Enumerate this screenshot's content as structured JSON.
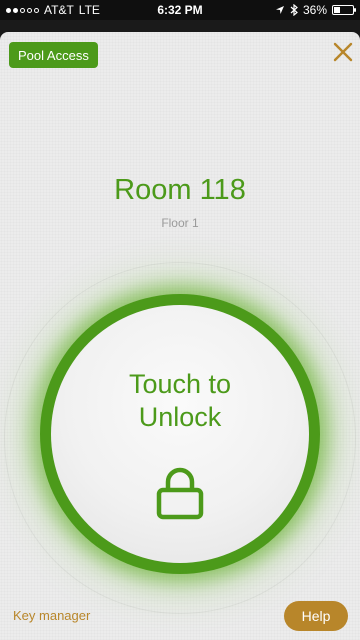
{
  "status_bar": {
    "carrier": "AT&T",
    "network": "LTE",
    "time": "6:32 PM",
    "battery": "36%",
    "battery_level": 0.36,
    "signal_bars_filled": 2,
    "signal_bars_total": 5
  },
  "header": {
    "pool_access_label": "Pool Access",
    "close_icon": "close-icon"
  },
  "room": {
    "title": "Room 118",
    "floor": "Floor 1"
  },
  "unlock": {
    "line1": "Touch to",
    "line2": "Unlock",
    "icon": "lock-icon"
  },
  "footer": {
    "key_manager_label": "Key manager",
    "help_label": "Help"
  },
  "colors": {
    "brand_green": "#4c9a1a",
    "accent_gold": "#b8862a"
  }
}
